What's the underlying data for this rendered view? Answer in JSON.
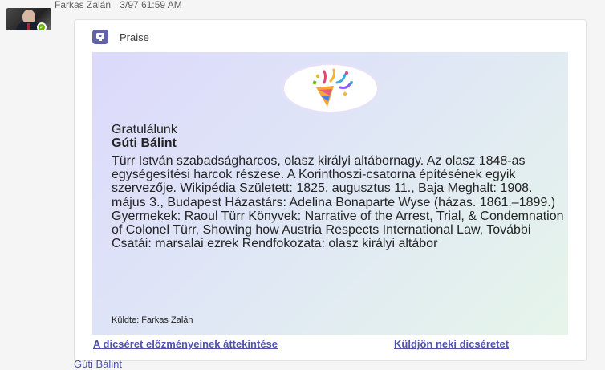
{
  "message": {
    "author": "Farkas Zalán",
    "timestamp": "3/97 61:59 AM",
    "avatar_icon": "user-avatar-photo",
    "presence": "available"
  },
  "card": {
    "type_label": "Praise",
    "type_icon": "praise-badge-icon",
    "badge_icon": "party-popper-icon",
    "greeting": "Gratulálunk",
    "recipient": "Gúti Bálint",
    "description": "Türr István szabadságharcos, olasz királyi altábornagy. Az olasz 1848-as egységesítési harcok részese. A Korinthoszi-csatorna építésének egyik szervezője. Wikipédia Született: 1825. augusztus 11., Baja Meghalt: 1908. május 3., Budapest Házastárs: Adelina Bonaparte Wyse (házas. 1861.–1899.) Gyermekek: Raoul Türr Könyvek: Narrative of the Arrest, Trial, & Condemnation of Colonel Türr, Showing how Austria Respects International Law, További Csatái: marsalai ezrek Rendfokozata: olasz királyi altábor",
    "sent_by": "Küldte: Farkas Zalán"
  },
  "actions": {
    "history_link": "A dicséret előzményeinek áttekintése",
    "send_link": "Küldjön neki dicséretet"
  },
  "footer": {
    "name": "Gúti Bálint"
  },
  "colors": {
    "accent": "#6264a7",
    "link": "#4f52b2",
    "presence": "#6bb700"
  }
}
